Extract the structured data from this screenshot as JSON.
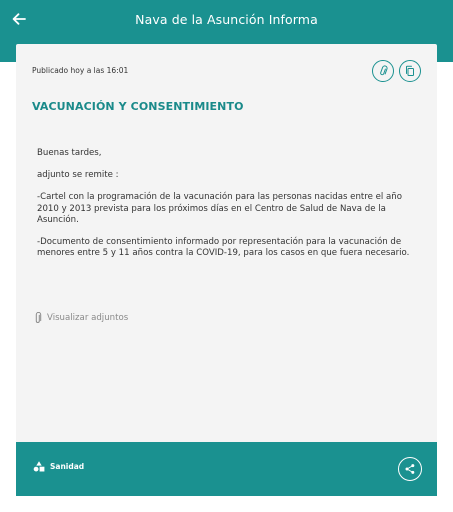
{
  "header": {
    "title": "Nava de la Asunción Informa",
    "back_icon": "arrow-left-icon"
  },
  "colors": {
    "accent": "#1a9190",
    "card_background": "#f4f4f4",
    "headline": "#1a8a8a"
  },
  "post": {
    "published": "Publicado hoy a las 16:01",
    "actions": [
      "paperclip-icon",
      "copy-icon"
    ],
    "title": "VACUNACIÓN Y CONSENTIMIENTO",
    "body": {
      "greeting": "Buenas tardes,",
      "intro": "adjunto se remite :",
      "item1": "-Cartel con la programación de la vacunación para las personas nacidas entre el año 2010 y 2013 prevista para los próximos días en el Centro de Salud de Nava de la Asunción.",
      "item2": "-Documento de consentimiento informado por representación para la vacunación de menores entre 5 y 11 años contra la COVID-19, para los casos en que fuera necesario."
    },
    "attachments_label": "Visualizar adjuntos"
  },
  "footer": {
    "category": "Sanidad",
    "category_icon": "shapes-icon",
    "share_icon": "share-icon"
  }
}
